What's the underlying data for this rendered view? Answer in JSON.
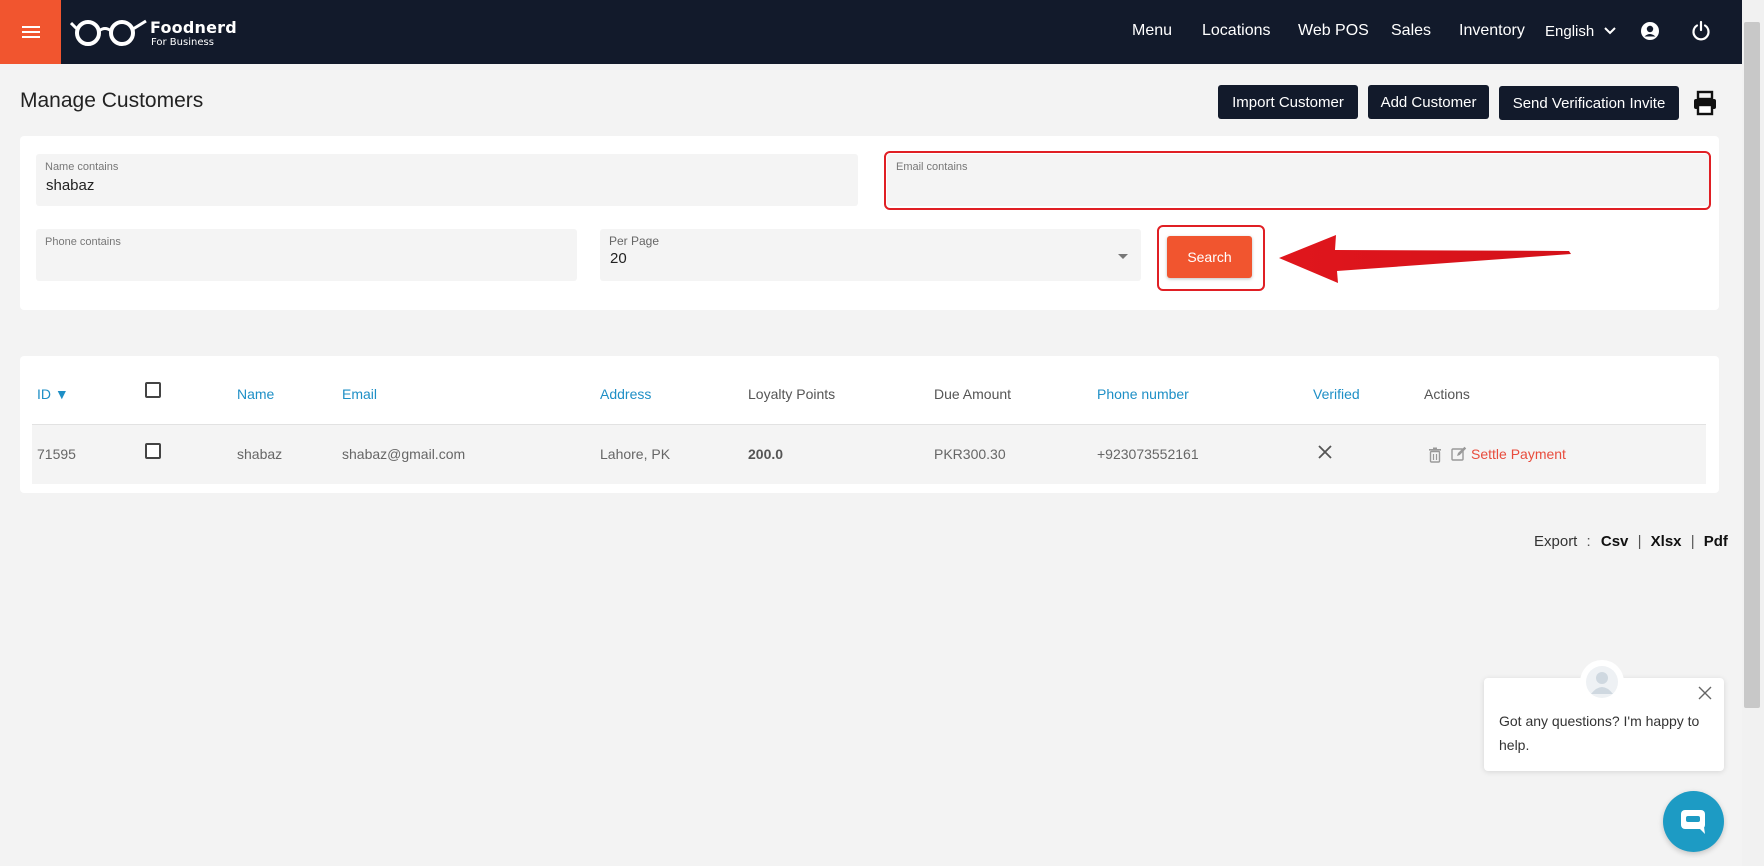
{
  "colors": {
    "accent": "#f1552f",
    "nav_bg": "#121a2b",
    "link": "#1e8fc6",
    "highlight": "#e01f24",
    "settle": "#e84c3d",
    "chat": "#1d9bc4"
  },
  "brand": {
    "name": "Foodnerd",
    "tagline": "For Business"
  },
  "nav": {
    "menu": "Menu",
    "locations": "Locations",
    "web_pos": "Web POS",
    "sales": "Sales",
    "inventory": "Inventory",
    "language": "English"
  },
  "page": {
    "title": "Manage Customers",
    "import_label": "Import Customer",
    "add_label": "Add Customer",
    "invite_label": "Send Verification Invite"
  },
  "filters": {
    "name": {
      "label": "Name contains",
      "value": "shabaz"
    },
    "email": {
      "label": "Email contains",
      "value": ""
    },
    "phone": {
      "label": "Phone contains",
      "value": ""
    },
    "per_page": {
      "label": "Per Page",
      "value": "20"
    },
    "search_label": "Search"
  },
  "table": {
    "headers": {
      "id": "ID ▼",
      "name": "Name",
      "email": "Email",
      "address": "Address",
      "loyalty": "Loyalty Points",
      "due": "Due Amount",
      "phone": "Phone number",
      "verified": "Verified",
      "actions": "Actions"
    },
    "rows": [
      {
        "id": "71595",
        "name": "shabaz",
        "email": "shabaz@gmail.com",
        "address": "Lahore, PK",
        "loyalty": "200.0",
        "due": "PKR300.30",
        "phone": "+923073552161",
        "verified": false,
        "settle_label": "Settle Payment"
      }
    ]
  },
  "export": {
    "label": "Export",
    "sep": ":",
    "csv": "Csv",
    "xlsx": "Xlsx",
    "pdf": "Pdf"
  },
  "chat": {
    "message": "Got any questions? I'm happy to help."
  }
}
